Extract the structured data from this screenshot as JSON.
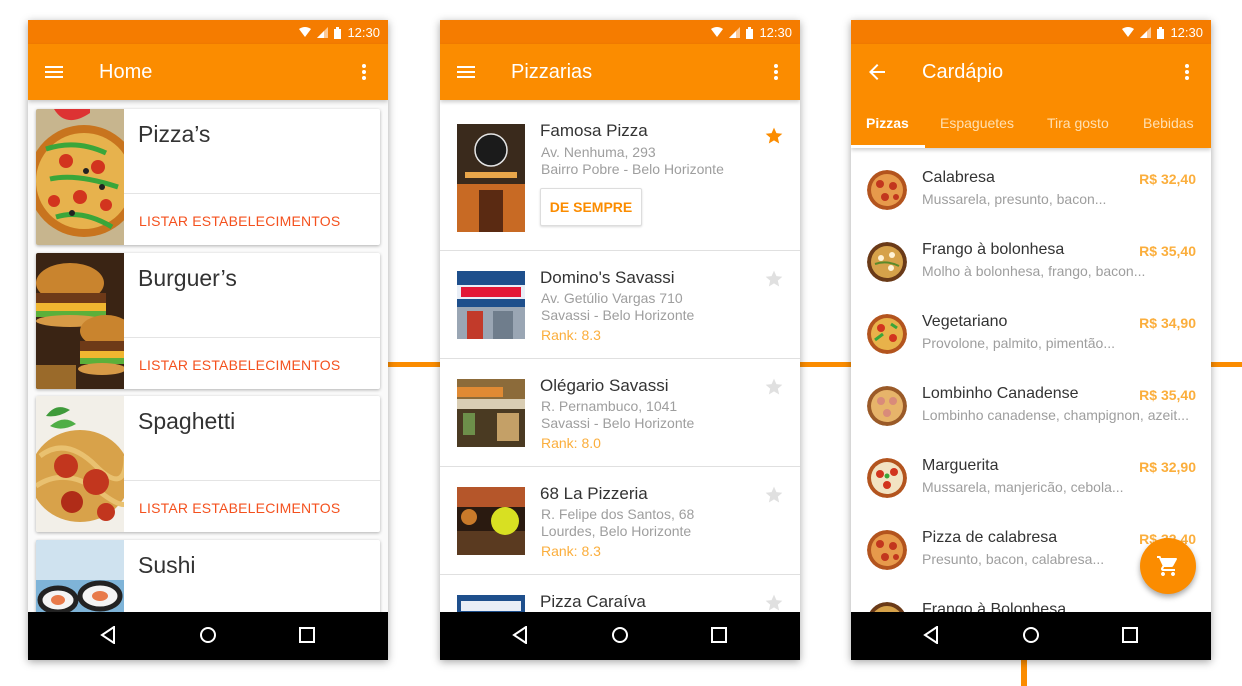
{
  "status_time": "12:30",
  "colors": {
    "primary": "#fb8c00",
    "status": "#f57c00",
    "accent": "#f4511e",
    "price": "#fbae3c"
  },
  "home": {
    "title": "Home",
    "categories": [
      {
        "name": "Pizza’s",
        "action": "LISTAR ESTABELECIMENTOS"
      },
      {
        "name": "Burguer’s",
        "action": "LISTAR ESTABELECIMENTOS"
      },
      {
        "name": "Spaghetti",
        "action": "LISTAR ESTABELECIMENTOS"
      },
      {
        "name": "Sushi",
        "action": ""
      }
    ]
  },
  "pizzarias": {
    "title": "Pizzarias",
    "shops": [
      {
        "name": "Famosa Pizza",
        "address": "Av. Nenhuma, 293",
        "district": "Bairro Pobre - Belo Horizonte",
        "button": "DE SEMPRE",
        "favorite": true
      },
      {
        "name": "Domino's Savassi",
        "address": "Av. Getúlio Vargas 710",
        "district": "Savassi - Belo Horizonte",
        "rank": "Rank: 8.3",
        "favorite": false
      },
      {
        "name": "Olégario Savassi",
        "address": "R. Pernambuco, 1041",
        "district": "Savassi - Belo Horizonte",
        "rank": "Rank: 8.0",
        "favorite": false
      },
      {
        "name": "68 La Pizzeria",
        "address": "R. Felipe dos Santos, 68",
        "district": "Lourdes, Belo Horizonte",
        "rank": "Rank: 8.3",
        "favorite": false
      },
      {
        "name": "Pizza Caraíva",
        "favorite": false
      }
    ]
  },
  "cardapio": {
    "title": "Cardápio",
    "tabs": [
      "Pizzas",
      "Espaguetes",
      "Tira gosto",
      "Bebidas"
    ],
    "items": [
      {
        "name": "Calabresa",
        "desc": "Mussarela, presunto, bacon...",
        "price": "R$ 32,40"
      },
      {
        "name": "Frango à bolonhesa",
        "desc": "Molho à bolonhesa, frango, bacon...",
        "price": "R$ 35,40"
      },
      {
        "name": "Vegetariano",
        "desc": "Provolone, palmito, pimentão...",
        "price": "R$ 34,90"
      },
      {
        "name": "Lombinho Canadense",
        "desc": "Lombinho canadense, champignon, azeit...",
        "price": "R$ 35,40"
      },
      {
        "name": "Marguerita",
        "desc": "Mussarela, manjericão, cebola...",
        "price": "R$ 32,90"
      },
      {
        "name": "Pizza de calabresa",
        "desc": "Presunto, bacon, calabresa...",
        "price": "R$ 32,40"
      },
      {
        "name": "Frango à Bolonhesa",
        "desc": "",
        "price": ""
      }
    ]
  }
}
